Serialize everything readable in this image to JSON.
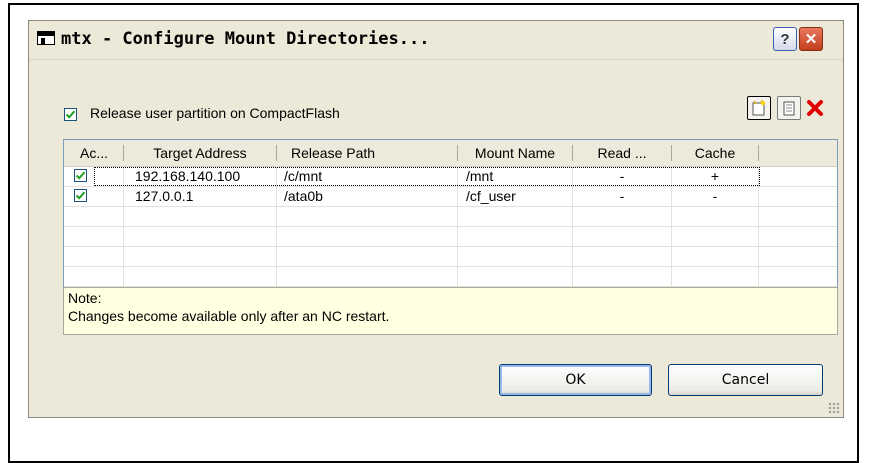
{
  "window": {
    "title": "mtx - Configure Mount Directories...",
    "help_label": "?",
    "close_label": "✕"
  },
  "options": {
    "release_partition_label": "Release user partition on CompactFlash",
    "release_partition_checked": true
  },
  "toolbar": {
    "new_icon": "new-entry-icon",
    "copy_icon": "copy-entry-icon",
    "delete_icon": "delete-entry-icon"
  },
  "grid": {
    "columns": [
      "Ac...",
      "Target Address",
      "Release Path",
      "Mount Name",
      "Read ...",
      "Cache"
    ],
    "rows": [
      {
        "active": true,
        "target": "192.168.140.100",
        "path": "/c/mnt",
        "mount": "/mnt",
        "read": "-",
        "cache": "+"
      },
      {
        "active": true,
        "target": "127.0.0.1",
        "path": "/ata0b",
        "mount": "/cf_user",
        "read": "-",
        "cache": "-"
      }
    ]
  },
  "note": {
    "title": "Note:",
    "text": "Changes become available only after an NC restart."
  },
  "buttons": {
    "ok": "OK",
    "cancel": "Cancel"
  },
  "colors": {
    "dialog_bg": "#ece9d8",
    "note_bg": "#ffffe1",
    "close_red": "#c23e1c",
    "check_green": "#21a121",
    "delete_red": "#e00000"
  }
}
